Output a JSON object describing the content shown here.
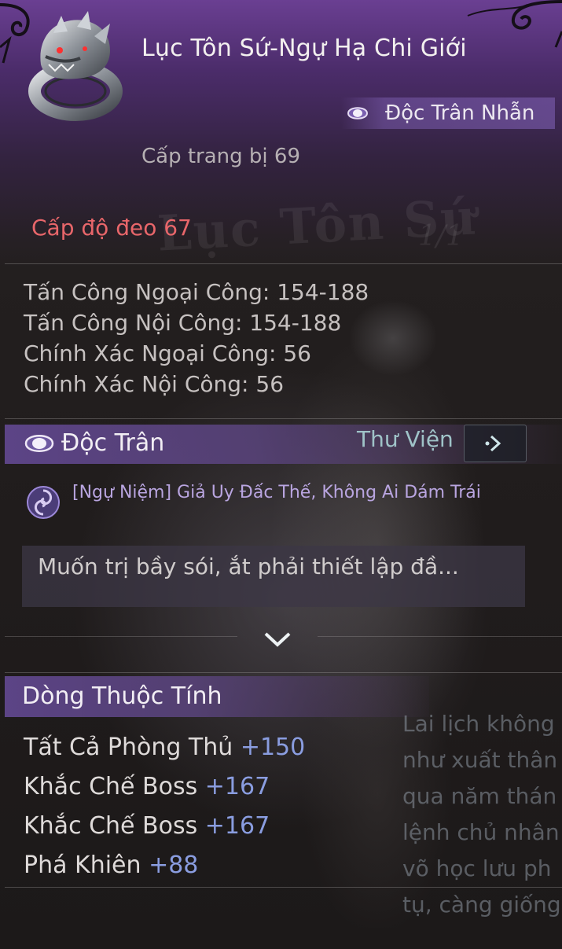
{
  "item": {
    "name": "Lục Tôn Sứ-Ngự Hạ Chi Giới",
    "type": "Độc Trân Nhẫn",
    "equip_level": "Cấp trang bị 69",
    "wear_level": "Cấp độ đeo 67",
    "icon": "wolf-ring-icon"
  },
  "watermark": {
    "title": "Lục Tôn Sứ",
    "count": "1/1"
  },
  "stats": [
    "Tấn Công Ngoại Công: 154-188",
    "Tấn Công Nội Công: 154-188",
    "Chính Xác Ngoại Công: 56",
    "Chính Xác Nội Công: 56"
  ],
  "doc_tran": {
    "title": "Độc Trân",
    "library_label": "Thư Viện",
    "skill": "[Ngự Niệm] Giả Uy Đấc Thế, Không Ai Dám Trái",
    "description": "Muốn trị bầy sói, ắt phải thiết lập đầ..."
  },
  "attributes": {
    "title": "Dòng Thuộc Tính",
    "items": [
      {
        "name": "Tất Cả Phòng Thủ",
        "value": "+150"
      },
      {
        "name": "Khắc Chế Boss",
        "value": "+167"
      },
      {
        "name": "Khắc Chế Boss",
        "value": "+167"
      },
      {
        "name": "Phá Khiên",
        "value": "+88"
      }
    ]
  },
  "lore_lines": [
    "Lai lịch không",
    "như xuất thân",
    "qua năm thán",
    "lệnh chủ nhân",
    "võ học lưu ph",
    "tụ, càng giống"
  ],
  "colors": {
    "accent_purple": "#6a3f92",
    "wear_level_red": "#e8666a",
    "attribute_value_blue": "#8a9de0",
    "library_teal": "#9fc3c8"
  }
}
